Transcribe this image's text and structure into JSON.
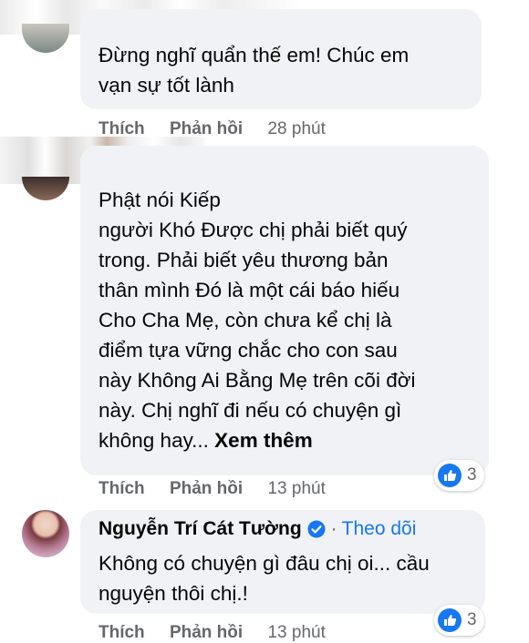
{
  "comments": [
    {
      "text": "Đừng nghĩ quẩn thế em! Chúc em\nvạn sự tốt lành",
      "like_label": "Thích",
      "reply_label": "Phản hồi",
      "time": "28 phút"
    },
    {
      "text": "Phật nói Kiếp\nngười Khó Được chị phải biết quý\ntrong. Phải biết yêu thương bản\nthân mình Đó là một cái báo hiếu\nCho Cha Mẹ, còn chưa kể chị là\nđiểm tựa vững chắc cho con sau\nnày Không Ai Bằng Mẹ trên cõi đời\nnày. Chị nghĩ đi nếu có chuyện gì\nkhông hay... ",
      "see_more": "Xem thêm",
      "like_label": "Thích",
      "reply_label": "Phản hồi",
      "time": "13 phút",
      "reaction_count": "3",
      "reaction_icon": "thumbs-up-icon"
    },
    {
      "author": "Nguyễn Trí Cát Tường",
      "verified_icon": "verified-badge-icon",
      "separator": "·",
      "follow_label": "Theo dõi",
      "text": "Không có chuyện gì đâu chị oi... cầu\nnguyện thôi chị.!",
      "like_label": "Thích",
      "reply_label": "Phản hồi",
      "time": "13 phút",
      "reaction_count": "3",
      "reaction_icon": "thumbs-up-icon"
    }
  ],
  "colors": {
    "bubble": "#f0f2f5",
    "accent": "#1877f2",
    "meta_text": "#65676b"
  }
}
